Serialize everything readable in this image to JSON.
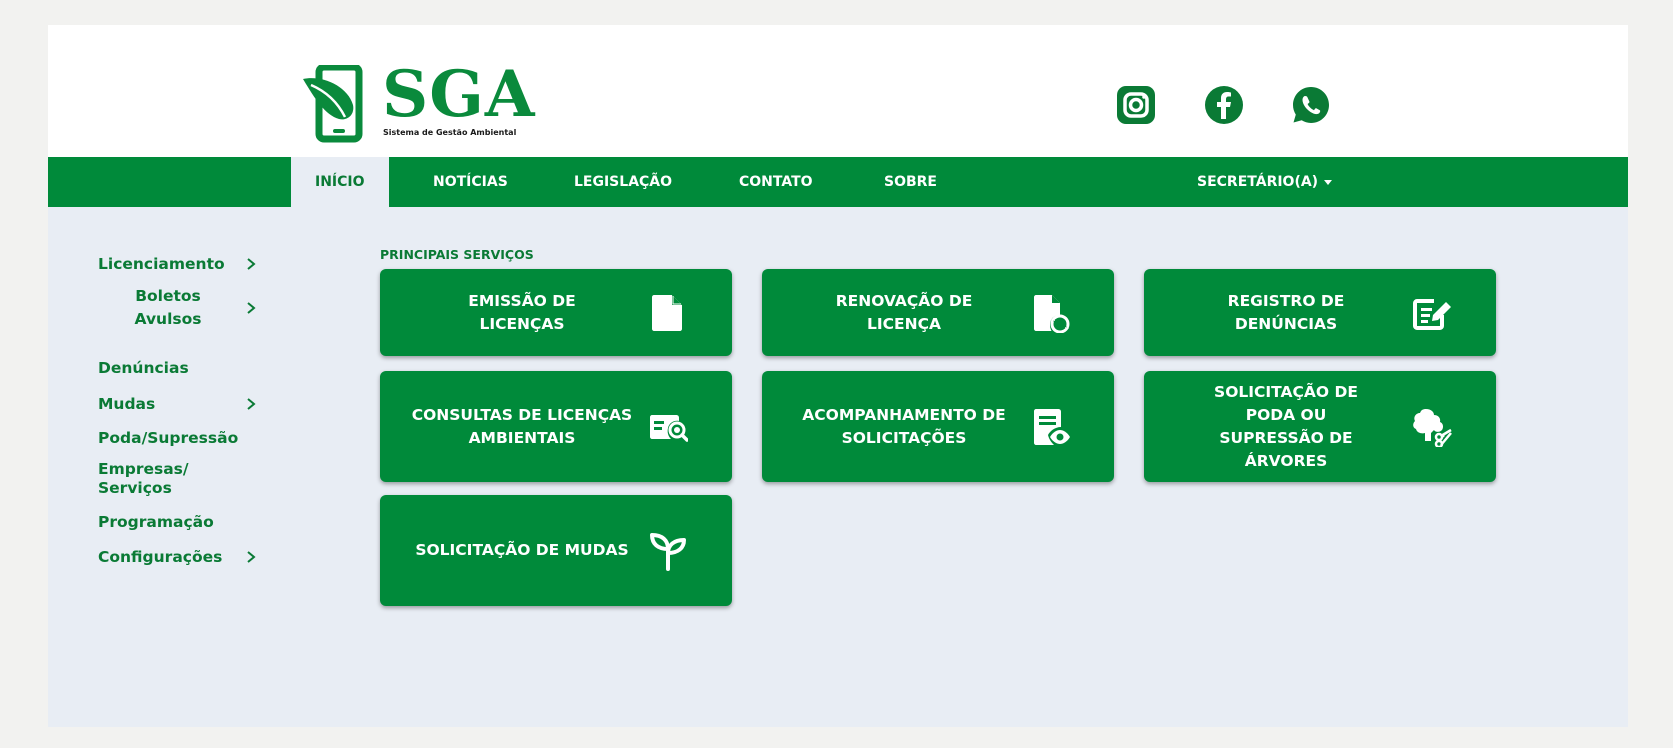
{
  "brand": {
    "name": "SGA",
    "subtitle": "Sistema de Gestão Ambiental",
    "color": "#008a3a"
  },
  "social": [
    {
      "icon": "instagram-icon"
    },
    {
      "icon": "facebook-icon"
    },
    {
      "icon": "whatsapp-icon"
    }
  ],
  "nav": {
    "items": [
      "INÍCIO",
      "NOTÍCIAS",
      "LEGISLAÇÃO",
      "CONTATO",
      "SOBRE"
    ],
    "active": "INÍCIO",
    "user_menu": "SECRETÁRIO(A)"
  },
  "sidebar": {
    "items": [
      {
        "label": "Licenciamento",
        "has_submenu": true
      },
      {
        "label": "Boletos Avulsos",
        "has_submenu": true
      },
      {
        "label": "Denúncias",
        "has_submenu": false
      },
      {
        "label": "Mudas",
        "has_submenu": true
      },
      {
        "label": "Poda/Supressão",
        "has_submenu": false
      },
      {
        "label": "Empresas/ Serviços",
        "has_submenu": false
      },
      {
        "label": "Programação",
        "has_submenu": false
      },
      {
        "label": "Configurações",
        "has_submenu": true
      }
    ]
  },
  "main": {
    "section_title": "PRINCIPAIS SERVIÇOS",
    "cards": [
      {
        "label": "EMISSÃO DE LICENÇAS",
        "icon": "document-icon"
      },
      {
        "label": "RENOVAÇÃO DE LICENÇA",
        "icon": "document-renew-icon"
      },
      {
        "label": "REGISTRO DE DENÚNCIAS",
        "icon": "edit-icon"
      },
      {
        "label": "CONSULTAS DE LICENÇAS AMBIENTAIS",
        "icon": "search-document-icon"
      },
      {
        "label": "ACOMPANHAMENTO DE SOLICITAÇÕES",
        "icon": "document-eye-icon"
      },
      {
        "label": "SOLICITAÇÃO DE PODA OU SUPRESSÃO DE ÁRVORES",
        "icon": "tree-scissors-icon"
      },
      {
        "label": "SOLICITAÇÃO DE MUDAS",
        "icon": "seedling-icon"
      }
    ]
  }
}
